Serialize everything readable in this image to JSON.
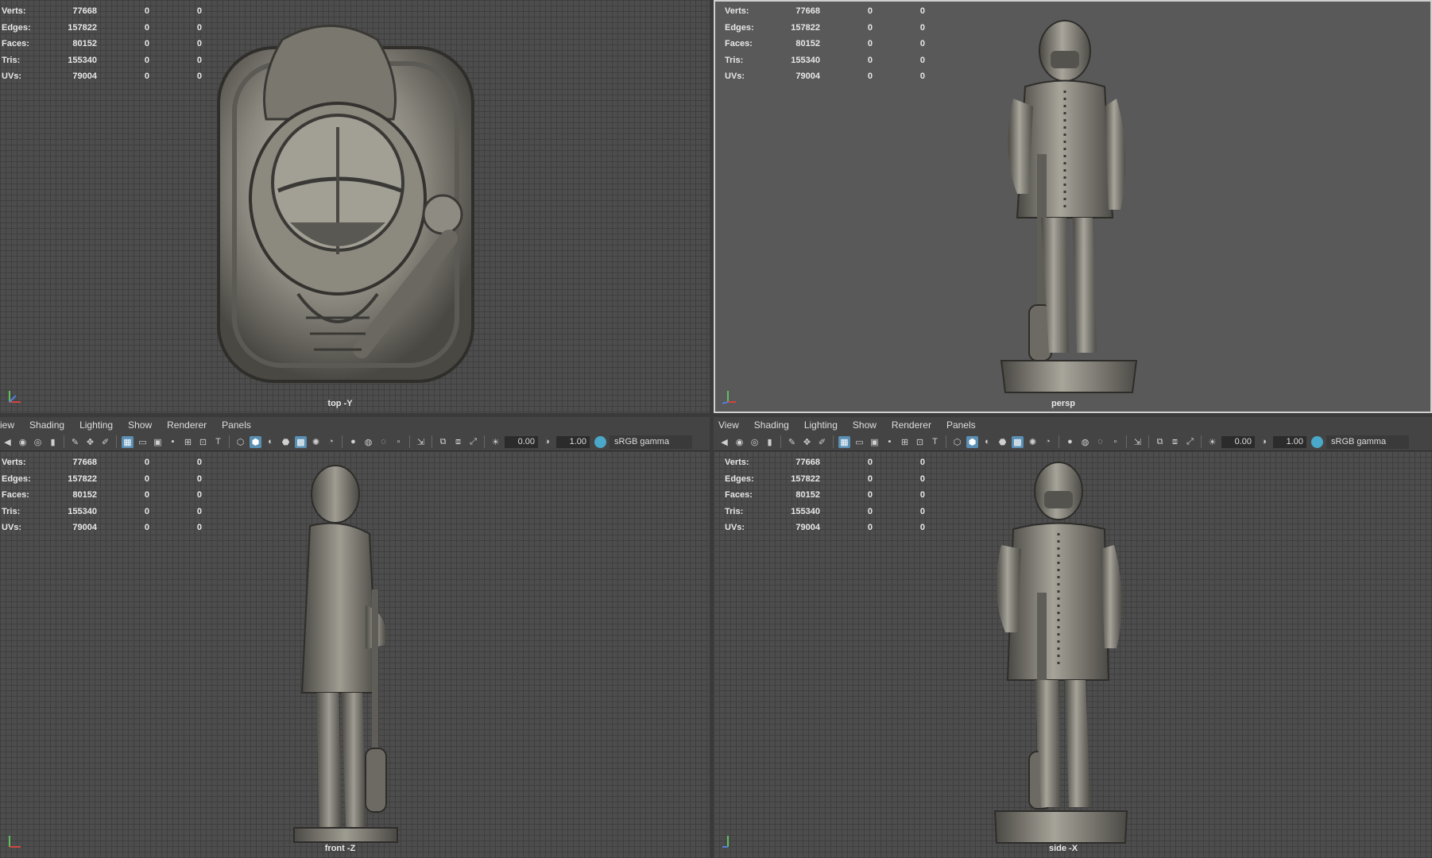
{
  "stats_labels": {
    "verts": "Verts:",
    "edges": "Edges:",
    "faces": "Faces:",
    "tris": "Tris:",
    "uvs": "UVs:"
  },
  "stats": {
    "verts": [
      "77668",
      "0",
      "0"
    ],
    "edges": [
      "157822",
      "0",
      "0"
    ],
    "faces": [
      "80152",
      "0",
      "0"
    ],
    "tris": [
      "155340",
      "0",
      "0"
    ],
    "uvs": [
      "79004",
      "0",
      "0"
    ]
  },
  "viewports": {
    "top_left": {
      "camera": "top -Y"
    },
    "top_right": {
      "camera": "persp"
    },
    "bottom_left": {
      "camera": "front -Z"
    },
    "bottom_right": {
      "camera": "side -X"
    }
  },
  "menu_left": {
    "view": "iew",
    "shading": "Shading",
    "lighting": "Lighting",
    "show": "Show",
    "renderer": "Renderer",
    "panels": "Panels"
  },
  "menu_right": {
    "view": "View",
    "shading": "Shading",
    "lighting": "Lighting",
    "show": "Show",
    "renderer": "Renderer",
    "panels": "Panels"
  },
  "toolbar": {
    "exposure": "0.00",
    "gamma_value": "1.00",
    "color_space": "sRGB gamma"
  },
  "colors": {
    "active_toggle": "#5a8fb4",
    "gamma_icon": "#4aa8c8",
    "viewport_grid": "#4d4d4d",
    "persp_bg": "#595959"
  },
  "icons": [
    "camera-icon",
    "bookmark-icon",
    "grid-icon",
    "shading-icon",
    "lighting-icon",
    "isolate-icon",
    "exposure-icon",
    "gamma-icon"
  ]
}
